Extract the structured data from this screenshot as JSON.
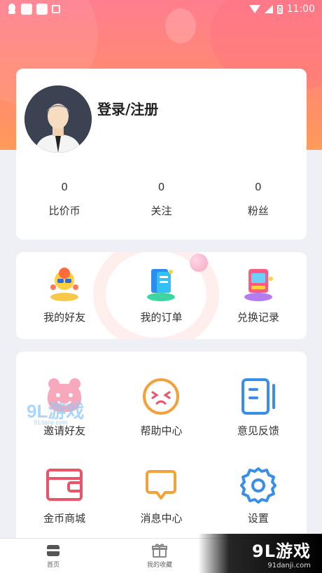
{
  "status_bar": {
    "time": "11:00"
  },
  "profile": {
    "login_label": "登录/注册",
    "stats": [
      {
        "value": "0",
        "label": "比价币"
      },
      {
        "value": "0",
        "label": "关注"
      },
      {
        "value": "0",
        "label": "粉丝"
      }
    ]
  },
  "tools": [
    {
      "label": "我的好友",
      "icon": "friends-icon"
    },
    {
      "label": "我的订单",
      "icon": "orders-icon"
    },
    {
      "label": "兑换记录",
      "icon": "exchange-record-icon"
    }
  ],
  "menu": [
    {
      "label": "邀请好友",
      "icon": "bear-icon",
      "color": "#f5a3b5"
    },
    {
      "label": "帮助中心",
      "icon": "help-face-icon",
      "color": "#f2a23b"
    },
    {
      "label": "意见反馈",
      "icon": "feedback-icon",
      "color": "#3a8ee6"
    },
    {
      "label": "金币商城",
      "icon": "wallet-icon",
      "color": "#e85569"
    },
    {
      "label": "消息中心",
      "icon": "message-icon",
      "color": "#f2a23b"
    },
    {
      "label": "设置",
      "icon": "gear-icon",
      "color": "#3a8ee6"
    }
  ],
  "tabbar": [
    {
      "label": "首页",
      "icon": "home-icon"
    },
    {
      "label": "我的收藏",
      "icon": "gift-icon"
    }
  ],
  "watermark": {
    "brand": "9L游戏",
    "site": "91danji.com"
  }
}
